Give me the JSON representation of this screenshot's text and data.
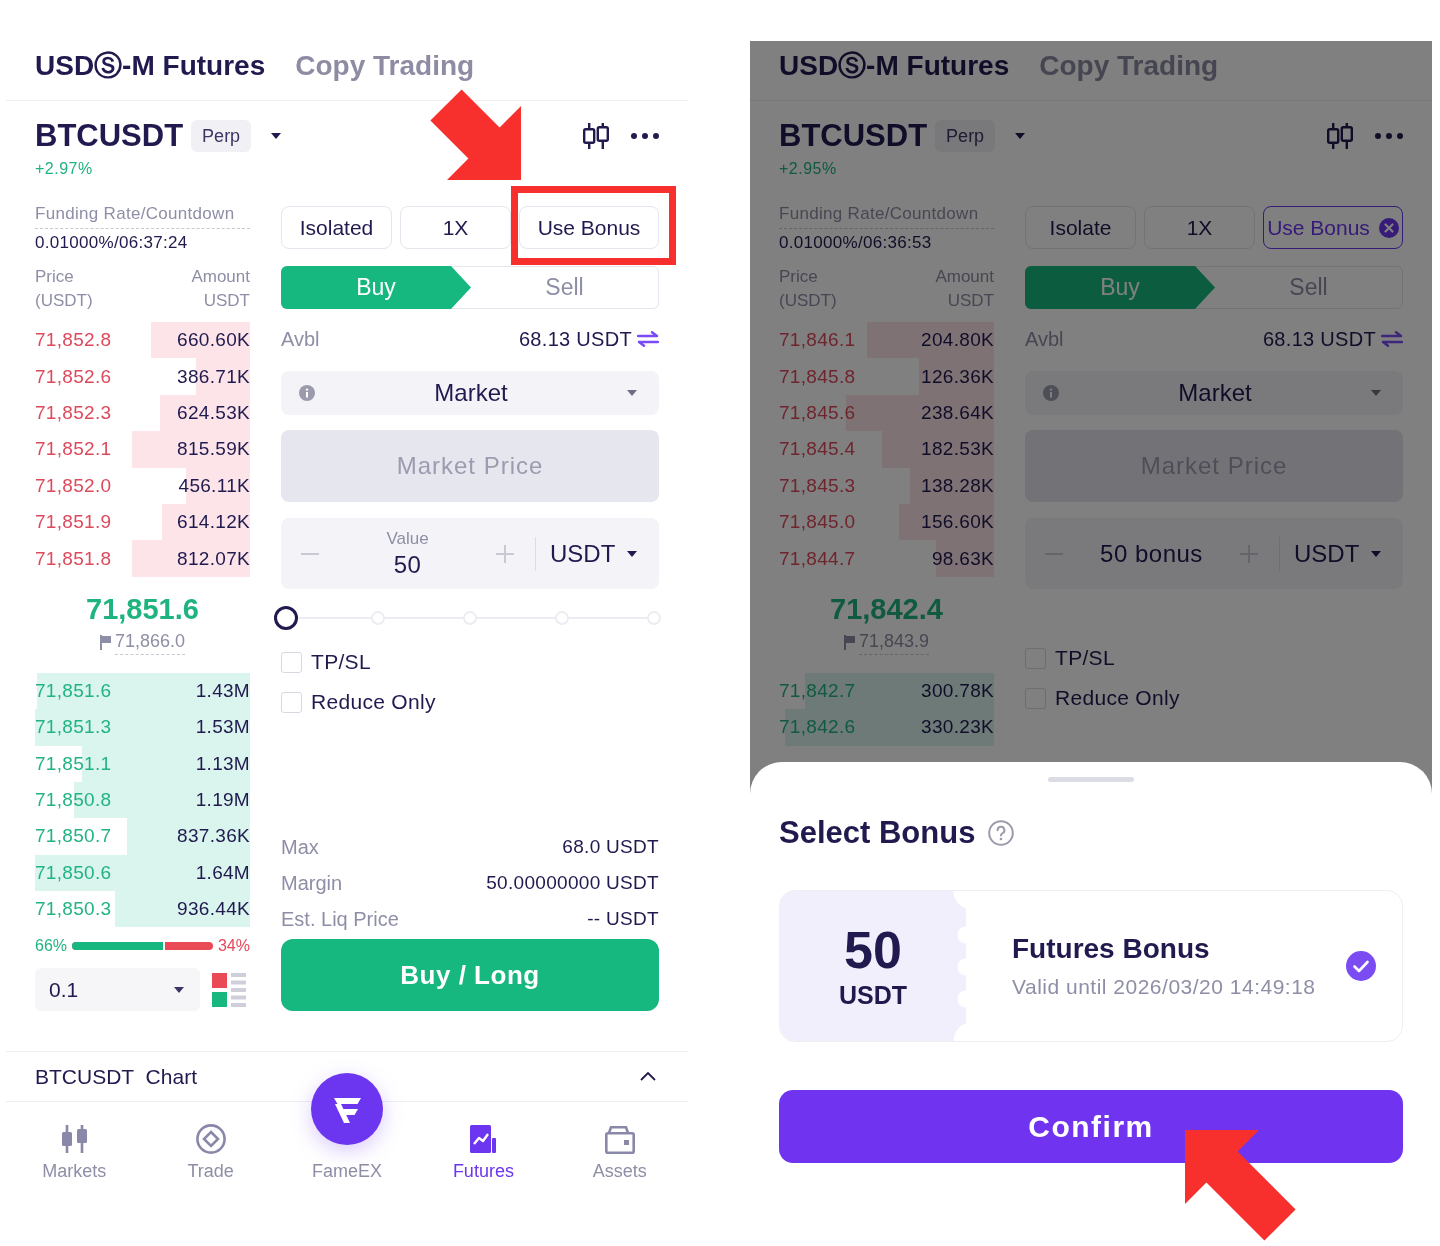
{
  "screens": [
    {
      "tabs": [
        {
          "label": "USDⓈ-M Futures",
          "selected": true
        },
        {
          "label": "Copy Trading",
          "selected": false
        }
      ],
      "pair": {
        "symbol": "BTCUSDT",
        "tag": "Perp",
        "change": "+2.97%"
      },
      "order_book": {
        "funding_label": "Funding Rate/Countdown",
        "funding_value": "0.01000%/06:37:24",
        "columns": [
          {
            "label": "Price",
            "unit": "(USDT)"
          },
          {
            "label": "Amount",
            "unit": "USDT"
          }
        ],
        "asks": [
          {
            "price": "71,852.8",
            "amount": "660.60K",
            "level": 0.46
          },
          {
            "price": "71,852.6",
            "amount": "386.71K",
            "level": 0.25
          },
          {
            "price": "71,852.3",
            "amount": "624.53K",
            "level": 0.42
          },
          {
            "price": "71,852.1",
            "amount": "815.59K",
            "level": 0.55
          },
          {
            "price": "71,852.0",
            "amount": "456.11K",
            "level": 0.3
          },
          {
            "price": "71,851.9",
            "amount": "614.12K",
            "level": 0.41
          },
          {
            "price": "71,851.8",
            "amount": "812.07K",
            "level": 0.55
          }
        ],
        "last_price": "71,851.6",
        "mark_price": "71,866.0",
        "bids": [
          {
            "price": "71,851.6",
            "amount": "1.43M",
            "level": 0.99
          },
          {
            "price": "71,851.3",
            "amount": "1.53M",
            "level": 1
          },
          {
            "price": "71,851.1",
            "amount": "1.13M",
            "level": 0.78
          },
          {
            "price": "71,850.8",
            "amount": "1.19M",
            "level": 0.82
          },
          {
            "price": "71,850.7",
            "amount": "837.36K",
            "level": 0.57
          },
          {
            "price": "71,850.6",
            "amount": "1.64M",
            "level": 1
          },
          {
            "price": "71,850.3",
            "amount": "936.44K",
            "level": 0.63
          }
        ],
        "ratio": {
          "buy": "66%",
          "sell": "34%",
          "level": 0.66
        },
        "precision": "0.1"
      },
      "form": {
        "margin_mode": "Isolated",
        "leverage": "1X",
        "bonus": {
          "label": "Use Bonus",
          "applied": false,
          "highlighted": true
        },
        "sides": [
          {
            "label": "Buy",
            "selected": true
          },
          {
            "label": "Sell",
            "selected": false
          }
        ],
        "available": {
          "label": "Avbl",
          "value": "68.13 USDT"
        },
        "order_type": "Market",
        "price_field": {
          "placeholder": "Market Price",
          "disabled": true
        },
        "amount": {
          "label": "Value",
          "value": "50",
          "unit": "USDT"
        },
        "slider": {
          "level": 0
        },
        "checkboxes": [
          {
            "label": "TP/SL",
            "checked": false
          },
          {
            "label": "Reduce Only",
            "checked": false
          }
        ],
        "summary": [
          {
            "label": "Max",
            "value": "68.0 USDT"
          },
          {
            "label": "Margin",
            "value": "50.00000000 USDT"
          },
          {
            "label": "Est. Liq Price",
            "value": "-- USDT"
          }
        ],
        "submit": "Buy / Long"
      },
      "chart_bar": {
        "label": "BTCUSDT Chart"
      },
      "nav": [
        {
          "kind": "candles",
          "label": "Markets",
          "selected": false
        },
        {
          "kind": "target",
          "label": "Trade",
          "selected": false
        },
        {
          "kind": "logo",
          "label": "FameEX",
          "selected": false
        },
        {
          "kind": "chart",
          "label": "Futures",
          "selected": true
        },
        {
          "kind": "wallet",
          "label": "Assets",
          "selected": false
        }
      ]
    },
    {
      "tabs": [
        {
          "label": "USDⓈ-M Futures",
          "selected": true
        },
        {
          "label": "Copy Trading",
          "selected": false
        }
      ],
      "pair": {
        "symbol": "BTCUSDT",
        "tag": "Perp",
        "change": "+2.95%"
      },
      "order_book": {
        "funding_label": "Funding Rate/Countdown",
        "funding_value": "0.01000%/06:36:53",
        "columns": [
          {
            "label": "Price",
            "unit": "(USDT)"
          },
          {
            "label": "Amount",
            "unit": "USDT"
          }
        ],
        "asks": [
          {
            "price": "71,846.1",
            "amount": "204.80K",
            "level": 0.59
          },
          {
            "price": "71,845.8",
            "amount": "126.36K",
            "level": 0.35
          },
          {
            "price": "71,845.6",
            "amount": "238.64K",
            "level": 0.69
          },
          {
            "price": "71,845.4",
            "amount": "182.53K",
            "level": 0.52
          },
          {
            "price": "71,845.3",
            "amount": "138.28K",
            "level": 0.39
          },
          {
            "price": "71,845.0",
            "amount": "156.60K",
            "level": 0.44
          },
          {
            "price": "71,844.7",
            "amount": "98.63K",
            "level": 0.27
          }
        ],
        "last_price": "71,842.4",
        "mark_price": "71,843.9",
        "bids": [
          {
            "price": "71,842.7",
            "amount": "300.78K",
            "level": 0.88
          },
          {
            "price": "71,842.6",
            "amount": "330.23K",
            "level": 0.97
          }
        ]
      },
      "form": {
        "margin_mode": "Isolate",
        "leverage": "1X",
        "bonus": {
          "label": "Use Bonus",
          "applied": true,
          "highlighted": false
        },
        "sides": [
          {
            "label": "Buy",
            "selected": true
          },
          {
            "label": "Sell",
            "selected": false
          }
        ],
        "available": {
          "label": "Avbl",
          "value": "68.13 USDT"
        },
        "order_type": "Market",
        "price_field": {
          "placeholder": "Market Price",
          "disabled": true
        },
        "amount": {
          "value": "50 bonus",
          "unit": "USDT"
        },
        "checkboxes": [
          {
            "label": "TP/SL",
            "checked": false
          },
          {
            "label": "Reduce Only",
            "checked": false
          }
        ]
      },
      "sheet": {
        "title": "Select Bonus",
        "bonuses": [
          {
            "amount": "50",
            "unit": "USDT",
            "name": "Futures Bonus",
            "validity": "Valid until 2026/03/20 14:49:18",
            "selected": true
          }
        ],
        "confirm": {
          "label": "Confirm",
          "highlighted": true
        }
      }
    }
  ]
}
